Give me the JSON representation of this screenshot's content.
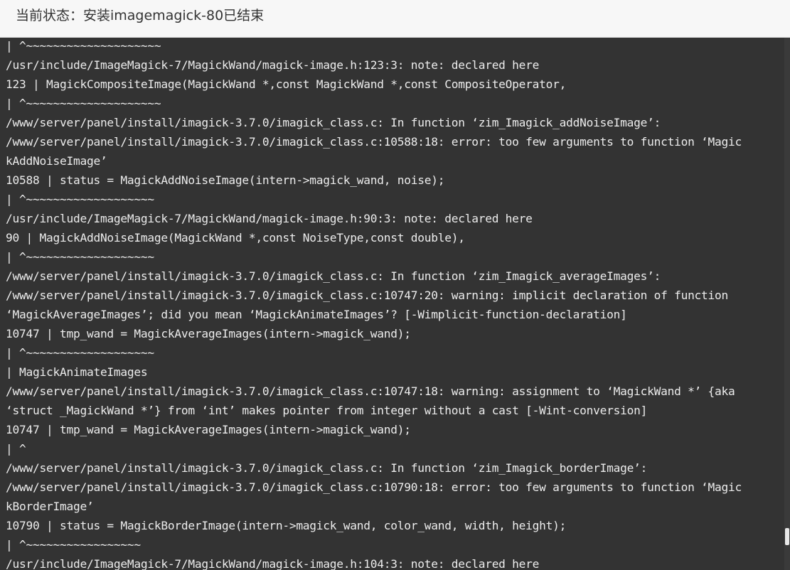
{
  "window": {
    "title": "当前状态：安装imagemagick-80已结束"
  },
  "log_lines": [
    "| ^~~~~~~~~~~~~~~~~~~~~",
    "/usr/include/ImageMagick-7/MagickWand/magick-image.h:123:3: note: declared here",
    "123 | MagickCompositeImage(MagickWand *,const MagickWand *,const CompositeOperator,",
    "| ^~~~~~~~~~~~~~~~~~~~~",
    "/www/server/panel/install/imagick-3.7.0/imagick_class.c: In function ‘zim_Imagick_addNoiseImage’:",
    "/www/server/panel/install/imagick-3.7.0/imagick_class.c:10588:18: error: too few arguments to function ‘Magic",
    "kAddNoiseImage’",
    "10588 | status = MagickAddNoiseImage(intern->magick_wand, noise);",
    "| ^~~~~~~~~~~~~~~~~~~~",
    "/usr/include/ImageMagick-7/MagickWand/magick-image.h:90:3: note: declared here",
    "90 | MagickAddNoiseImage(MagickWand *,const NoiseType,const double),",
    "| ^~~~~~~~~~~~~~~~~~~~",
    "/www/server/panel/install/imagick-3.7.0/imagick_class.c: In function ‘zim_Imagick_averageImages’:",
    "/www/server/panel/install/imagick-3.7.0/imagick_class.c:10747:20: warning: implicit declaration of function",
    "‘MagickAverageImages’; did you mean ‘MagickAnimateImages’? [-Wimplicit-function-declaration]",
    "10747 | tmp_wand = MagickAverageImages(intern->magick_wand);",
    "| ^~~~~~~~~~~~~~~~~~~~",
    "| MagickAnimateImages",
    "/www/server/panel/install/imagick-3.7.0/imagick_class.c:10747:18: warning: assignment to ‘MagickWand *’ {aka",
    "‘struct _MagickWand *’} from ‘int’ makes pointer from integer without a cast [-Wint-conversion]",
    "10747 | tmp_wand = MagickAverageImages(intern->magick_wand);",
    "| ^",
    "/www/server/panel/install/imagick-3.7.0/imagick_class.c: In function ‘zim_Imagick_borderImage’:",
    "/www/server/panel/install/imagick-3.7.0/imagick_class.c:10790:18: error: too few arguments to function ‘Magic",
    "kBorderImage’",
    "10790 | status = MagickBorderImage(intern->magick_wand, color_wand, width, height);",
    "| ^~~~~~~~~~~~~~~~~~",
    "/usr/include/ImageMagick-7/MagickWand/magick-image.h:104:3: note: declared here"
  ],
  "colors": {
    "terminal_bg": "#333333",
    "terminal_text": "#ececec",
    "titlebar_bg": "#f7f7f7",
    "title_text": "#333333"
  }
}
